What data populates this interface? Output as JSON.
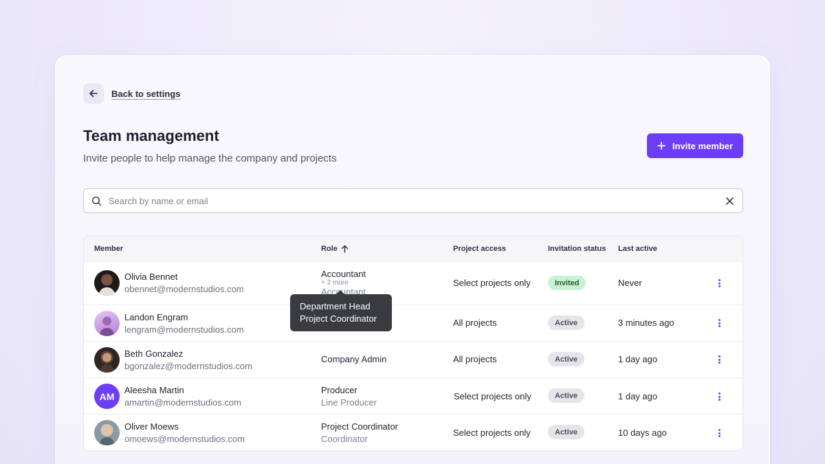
{
  "back": {
    "label": "Back to settings"
  },
  "header": {
    "title": "Team management",
    "subtitle": "Invite people to help manage the company and projects",
    "invite_label": "Invite member"
  },
  "search": {
    "placeholder": "Search by name or email",
    "value": ""
  },
  "table": {
    "columns": {
      "member": "Member",
      "role": "Role",
      "access": "Project access",
      "status": "Invitation status",
      "last_active": "Last active"
    },
    "rows": [
      {
        "name": "Olivia Bennet",
        "email": "obennet@modernstudios.com",
        "role": "Accountant",
        "role_more": "+ 2 more",
        "role_sub": "Accountant",
        "access": "Select projects only",
        "status": "Invited",
        "last_active": "Never"
      },
      {
        "name": "Landon Engram",
        "email": "lengram@modernstudios.com",
        "role": "",
        "role_sub": "",
        "access": "All projects",
        "status": "Active",
        "last_active": "3 minutes ago"
      },
      {
        "name": "Beth Gonzalez",
        "email": "bgonzalez@modernstudios.com",
        "role": "Company Admin",
        "role_sub": "",
        "access": "All projects",
        "status": "Active",
        "last_active": "1 day ago"
      },
      {
        "name": "Aleesha Martin",
        "email": "amartin@modernstudios.com",
        "initials": "AM",
        "role": "Producer",
        "role_sub": "Line Producer",
        "access": "Select projects only",
        "status": "Active",
        "last_active": "1 day ago"
      },
      {
        "name": "Oliver Moews",
        "email": "omoews@modernstudios.com",
        "role": "Project Coordinator",
        "role_sub": "Coordinator",
        "access": "Select projects only",
        "status": "Active",
        "last_active": "10 days ago"
      }
    ]
  },
  "tooltip": {
    "line1": "Department Head",
    "line2": "Project Coordinator"
  },
  "colors": {
    "accent": "#6c3ef5",
    "invited_badge": "#c9f1d3",
    "active_badge": "#e4e4ea"
  },
  "icons": {
    "back": "arrow-left-icon",
    "invite": "plus-icon",
    "search": "search-icon",
    "clear": "close-icon",
    "sort": "arrow-up-icon",
    "row_menu": "kebab-menu-icon"
  }
}
